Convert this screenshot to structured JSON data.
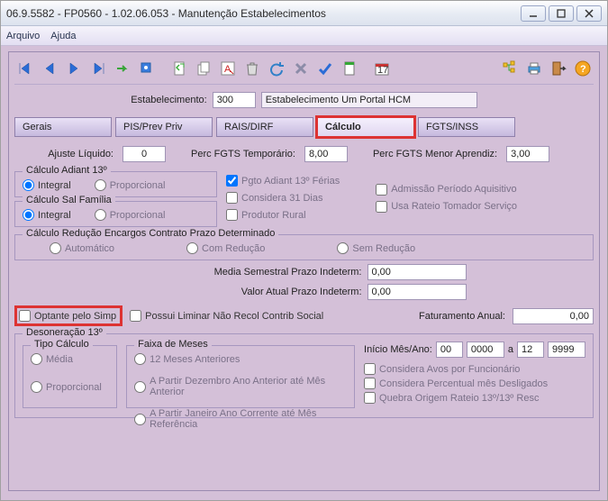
{
  "window": {
    "title": "06.9.5582 - FP0560 - 1.02.06.053 - Manutenção Estabelecimentos"
  },
  "menu": {
    "arquivo": "Arquivo",
    "ajuda": "Ajuda"
  },
  "estab": {
    "label": "Estabelecimento:",
    "code": "300",
    "name": "Estabelecimento Um Portal HCM"
  },
  "tabs": {
    "gerais": "Gerais",
    "pis": "PIS/Prev Priv",
    "rais": "RAIS/DIRF",
    "calculo": "Cálculo",
    "fgts": "FGTS/INSS"
  },
  "fields": {
    "ajuste_label": "Ajuste Líquido:",
    "ajuste": "0",
    "perc_temp_label": "Perc FGTS Temporário:",
    "perc_temp": "8,00",
    "perc_apr_label": "Perc FGTS Menor Aprendiz:",
    "perc_apr": "3,00"
  },
  "grp_adiant": {
    "caption": "Cálculo Adiant 13º",
    "integral": "Integral",
    "prop": "Proporcional"
  },
  "grp_salfam": {
    "caption": "Cálculo Sal Família",
    "integral": "Integral",
    "prop": "Proporcional"
  },
  "checks_b": {
    "pgto": "Pgto Adiant 13º Férias",
    "trinta": "Considera 31 Dias",
    "rural": "Produtor Rural",
    "periodo": "Admissão Período Aquisitivo",
    "rateio": "Usa Rateio Tomador Serviço"
  },
  "grp_reducao": {
    "caption": "Cálculo Redução Encargos Contrato Prazo Determinado",
    "auto": "Automático",
    "com": "Com Redução",
    "sem": "Sem Redução"
  },
  "center": {
    "media_label": "Media Semestral Prazo Indeterm:",
    "media": "0,00",
    "valor_label": "Valor Atual Prazo Indeterm:",
    "valor": "0,00"
  },
  "simp": {
    "optante": "Optante pelo Simp",
    "liminar": "Possui Liminar Não Recol Contrib Social",
    "fat_label": "Faturamento Anual:",
    "fat": "0,00"
  },
  "deson": {
    "caption": "Desoneração 13º",
    "tipo_caption": "Tipo Cálculo",
    "media": "Média",
    "prop": "Proporcional",
    "faixa_caption": "Faixa de Meses",
    "r1": "12 Meses Anteriores",
    "r2": "A Partir Dezembro Ano Anterior até Mês Anterior",
    "r3": "A Partir Janeiro Ano Corrente até Mês Referência",
    "inicio_label": "Início Mês/Ano:",
    "m1": "00",
    "y1": "0000",
    "a": "a",
    "m2": "12",
    "y2": "9999",
    "c1": "Considera Avos por Funcionário",
    "c2": "Considera Percentual mês Desligados",
    "c3": "Quebra Origem Rateio 13º/13º Resc"
  },
  "icons": {
    "first": "first",
    "prev": "prev",
    "next": "next",
    "last": "last"
  }
}
